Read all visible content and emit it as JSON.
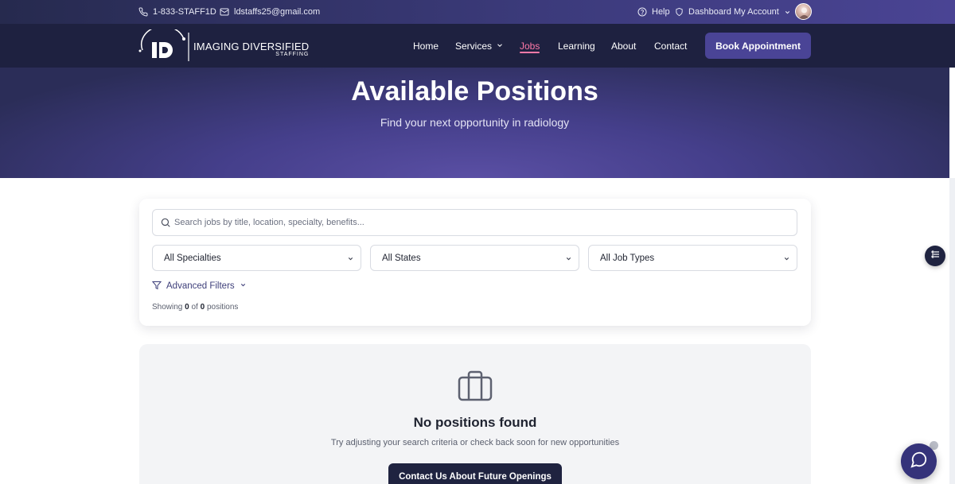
{
  "topbar": {
    "phone": "1-833-STAFF1D",
    "email": "ldstaffs25@gmail.com",
    "help": "Help",
    "dashboard": "Dashboard",
    "account": "My Account"
  },
  "brand": {
    "name": "IMAGING DIVERSIFIED",
    "tagline": "STAFFING"
  },
  "nav": {
    "home": "Home",
    "services": "Services",
    "jobs": "Jobs",
    "learning": "Learning",
    "about": "About",
    "contact": "Contact",
    "book": "Book Appointment",
    "active": "Jobs"
  },
  "hero": {
    "title": "Available Positions",
    "subtitle": "Find your next opportunity in radiology"
  },
  "filters": {
    "search_placeholder": "Search jobs by title, location, specialty, benefits...",
    "specialty": "All Specialties",
    "state": "All States",
    "job_type": "All Job Types",
    "advanced": "Advanced Filters",
    "showing_prefix": "Showing",
    "showing_count": "0",
    "showing_of": "of",
    "showing_total": "0",
    "showing_suffix": "positions"
  },
  "empty": {
    "title": "No positions found",
    "message": "Try adjusting your search criteria or check back soon for new opportunities",
    "button": "Contact Us About Future Openings"
  },
  "colors": {
    "accent": "#4a4496",
    "active_link": "#ff79a8",
    "navbar": "#1e2140"
  }
}
